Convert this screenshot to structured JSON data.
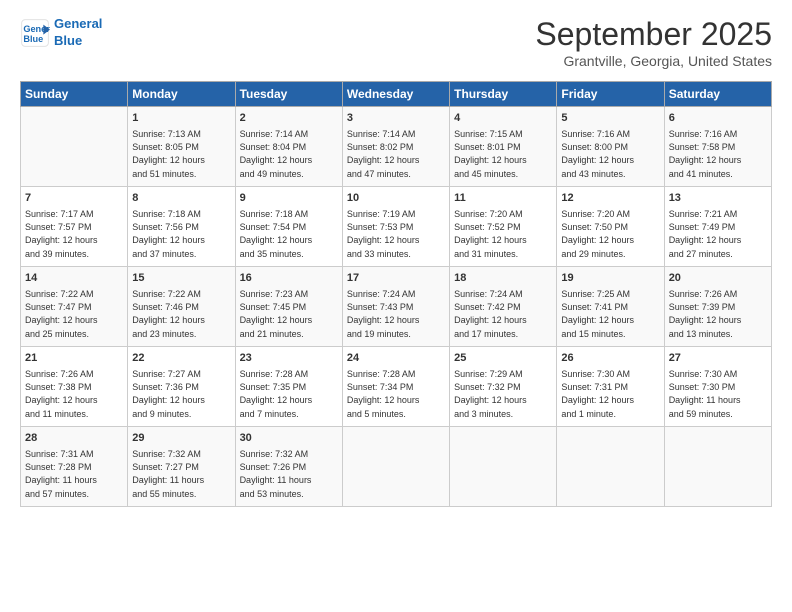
{
  "header": {
    "logo_line1": "General",
    "logo_line2": "Blue",
    "title": "September 2025",
    "subtitle": "Grantville, Georgia, United States"
  },
  "columns": [
    "Sunday",
    "Monday",
    "Tuesday",
    "Wednesday",
    "Thursday",
    "Friday",
    "Saturday"
  ],
  "weeks": [
    [
      {
        "day": "",
        "info": ""
      },
      {
        "day": "1",
        "info": "Sunrise: 7:13 AM\nSunset: 8:05 PM\nDaylight: 12 hours\nand 51 minutes."
      },
      {
        "day": "2",
        "info": "Sunrise: 7:14 AM\nSunset: 8:04 PM\nDaylight: 12 hours\nand 49 minutes."
      },
      {
        "day": "3",
        "info": "Sunrise: 7:14 AM\nSunset: 8:02 PM\nDaylight: 12 hours\nand 47 minutes."
      },
      {
        "day": "4",
        "info": "Sunrise: 7:15 AM\nSunset: 8:01 PM\nDaylight: 12 hours\nand 45 minutes."
      },
      {
        "day": "5",
        "info": "Sunrise: 7:16 AM\nSunset: 8:00 PM\nDaylight: 12 hours\nand 43 minutes."
      },
      {
        "day": "6",
        "info": "Sunrise: 7:16 AM\nSunset: 7:58 PM\nDaylight: 12 hours\nand 41 minutes."
      }
    ],
    [
      {
        "day": "7",
        "info": "Sunrise: 7:17 AM\nSunset: 7:57 PM\nDaylight: 12 hours\nand 39 minutes."
      },
      {
        "day": "8",
        "info": "Sunrise: 7:18 AM\nSunset: 7:56 PM\nDaylight: 12 hours\nand 37 minutes."
      },
      {
        "day": "9",
        "info": "Sunrise: 7:18 AM\nSunset: 7:54 PM\nDaylight: 12 hours\nand 35 minutes."
      },
      {
        "day": "10",
        "info": "Sunrise: 7:19 AM\nSunset: 7:53 PM\nDaylight: 12 hours\nand 33 minutes."
      },
      {
        "day": "11",
        "info": "Sunrise: 7:20 AM\nSunset: 7:52 PM\nDaylight: 12 hours\nand 31 minutes."
      },
      {
        "day": "12",
        "info": "Sunrise: 7:20 AM\nSunset: 7:50 PM\nDaylight: 12 hours\nand 29 minutes."
      },
      {
        "day": "13",
        "info": "Sunrise: 7:21 AM\nSunset: 7:49 PM\nDaylight: 12 hours\nand 27 minutes."
      }
    ],
    [
      {
        "day": "14",
        "info": "Sunrise: 7:22 AM\nSunset: 7:47 PM\nDaylight: 12 hours\nand 25 minutes."
      },
      {
        "day": "15",
        "info": "Sunrise: 7:22 AM\nSunset: 7:46 PM\nDaylight: 12 hours\nand 23 minutes."
      },
      {
        "day": "16",
        "info": "Sunrise: 7:23 AM\nSunset: 7:45 PM\nDaylight: 12 hours\nand 21 minutes."
      },
      {
        "day": "17",
        "info": "Sunrise: 7:24 AM\nSunset: 7:43 PM\nDaylight: 12 hours\nand 19 minutes."
      },
      {
        "day": "18",
        "info": "Sunrise: 7:24 AM\nSunset: 7:42 PM\nDaylight: 12 hours\nand 17 minutes."
      },
      {
        "day": "19",
        "info": "Sunrise: 7:25 AM\nSunset: 7:41 PM\nDaylight: 12 hours\nand 15 minutes."
      },
      {
        "day": "20",
        "info": "Sunrise: 7:26 AM\nSunset: 7:39 PM\nDaylight: 12 hours\nand 13 minutes."
      }
    ],
    [
      {
        "day": "21",
        "info": "Sunrise: 7:26 AM\nSunset: 7:38 PM\nDaylight: 12 hours\nand 11 minutes."
      },
      {
        "day": "22",
        "info": "Sunrise: 7:27 AM\nSunset: 7:36 PM\nDaylight: 12 hours\nand 9 minutes."
      },
      {
        "day": "23",
        "info": "Sunrise: 7:28 AM\nSunset: 7:35 PM\nDaylight: 12 hours\nand 7 minutes."
      },
      {
        "day": "24",
        "info": "Sunrise: 7:28 AM\nSunset: 7:34 PM\nDaylight: 12 hours\nand 5 minutes."
      },
      {
        "day": "25",
        "info": "Sunrise: 7:29 AM\nSunset: 7:32 PM\nDaylight: 12 hours\nand 3 minutes."
      },
      {
        "day": "26",
        "info": "Sunrise: 7:30 AM\nSunset: 7:31 PM\nDaylight: 12 hours\nand 1 minute."
      },
      {
        "day": "27",
        "info": "Sunrise: 7:30 AM\nSunset: 7:30 PM\nDaylight: 11 hours\nand 59 minutes."
      }
    ],
    [
      {
        "day": "28",
        "info": "Sunrise: 7:31 AM\nSunset: 7:28 PM\nDaylight: 11 hours\nand 57 minutes."
      },
      {
        "day": "29",
        "info": "Sunrise: 7:32 AM\nSunset: 7:27 PM\nDaylight: 11 hours\nand 55 minutes."
      },
      {
        "day": "30",
        "info": "Sunrise: 7:32 AM\nSunset: 7:26 PM\nDaylight: 11 hours\nand 53 minutes."
      },
      {
        "day": "",
        "info": ""
      },
      {
        "day": "",
        "info": ""
      },
      {
        "day": "",
        "info": ""
      },
      {
        "day": "",
        "info": ""
      }
    ]
  ]
}
